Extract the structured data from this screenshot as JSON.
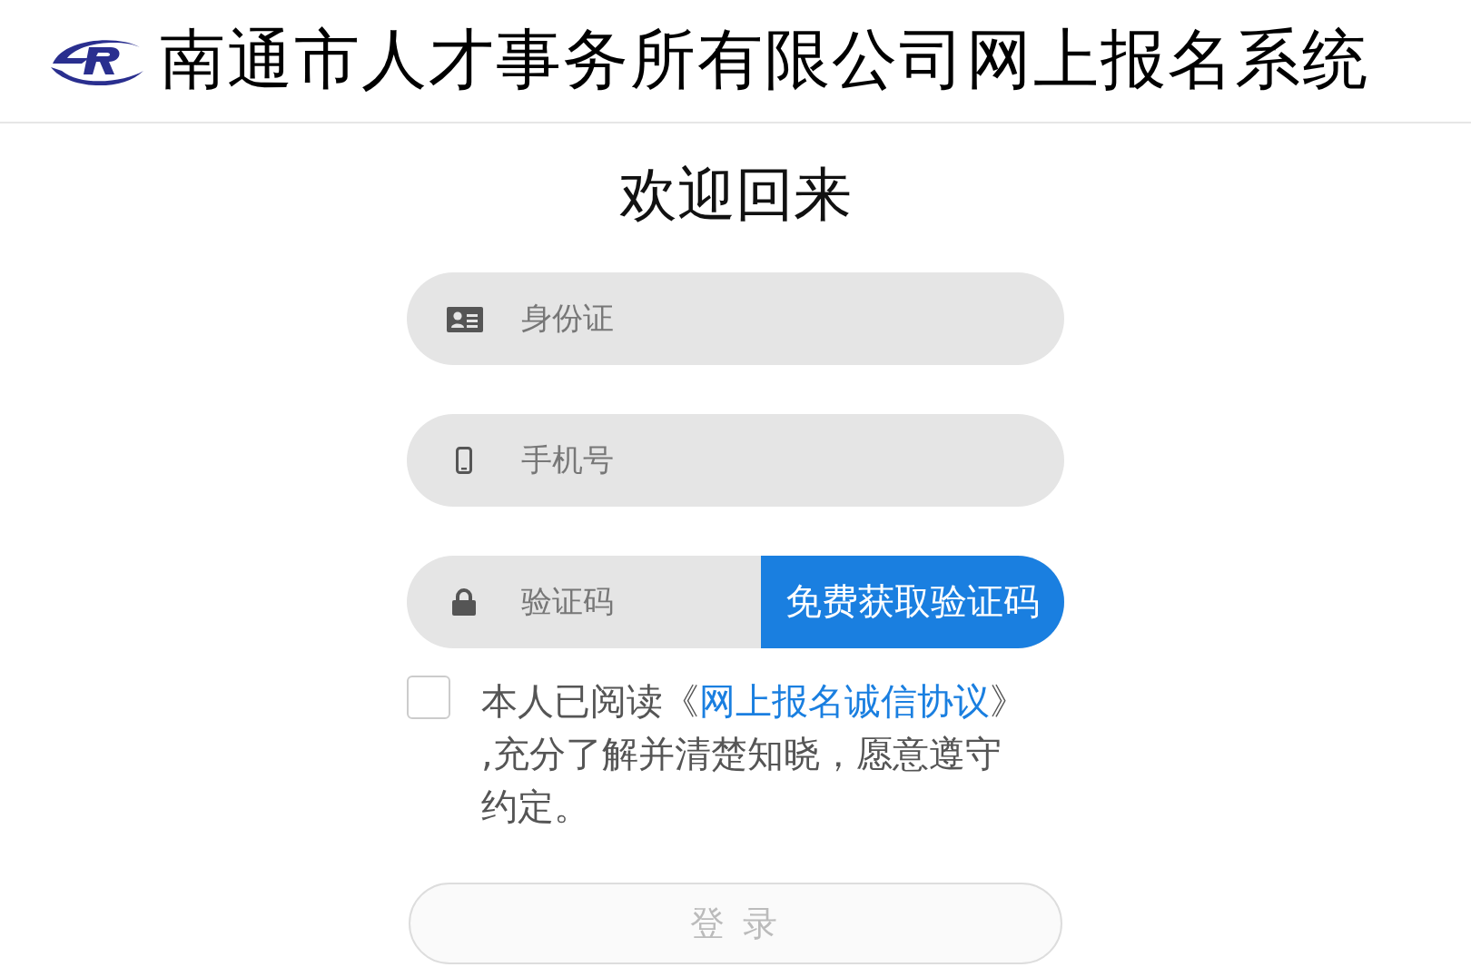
{
  "header": {
    "title": "南通市人才事务所有限公司网上报名系统"
  },
  "heading": "欢迎回来",
  "fields": [
    {
      "kind": "id",
      "placeholder": "身份证"
    },
    {
      "kind": "phone",
      "placeholder": "手机号"
    },
    {
      "kind": "code",
      "placeholder": "验证码",
      "button": "免费获取验证码"
    }
  ],
  "agreement": {
    "checked": false,
    "before": "本人已阅读《",
    "link": "网上报名诚信协议",
    "after": "》,充分了解并清楚知晓，愿意遵守约定。"
  },
  "login": {
    "label": "登 录",
    "disabled": true
  }
}
